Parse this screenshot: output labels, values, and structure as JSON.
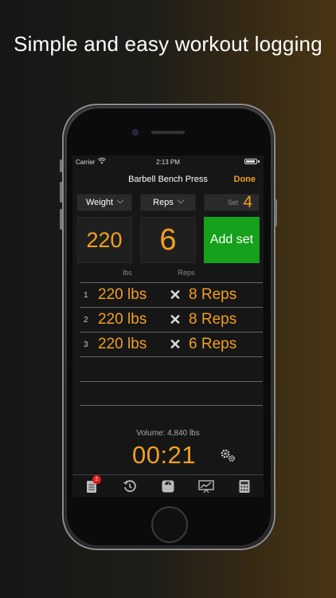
{
  "headline": "Simple and easy workout logging",
  "status_bar": {
    "carrier": "Carrier",
    "time": "2:13 PM"
  },
  "nav": {
    "title": "Barbell Bench Press",
    "done_label": "Done"
  },
  "selectors": {
    "weight_label": "Weight",
    "reps_label": "Reps",
    "set_label": "Set",
    "set_number": "4"
  },
  "inputs": {
    "weight_value": "220",
    "reps_value": "6",
    "weight_unit": "lbs",
    "reps_unit": "Reps"
  },
  "add_set_label": "Add set",
  "sets": [
    {
      "index": "1",
      "weight": "220 lbs",
      "separator": "✕",
      "reps": "8 Reps"
    },
    {
      "index": "2",
      "weight": "220 lbs",
      "separator": "✕",
      "reps": "8 Reps"
    },
    {
      "index": "3",
      "weight": "220 lbs",
      "separator": "✕",
      "reps": "6 Reps"
    }
  ],
  "volume": "Volume: 4,840 lbs",
  "timer": "00:21",
  "tabbar": {
    "items": [
      {
        "icon": "notepad-icon",
        "badge": "2"
      },
      {
        "icon": "history-icon"
      },
      {
        "icon": "scale-icon"
      },
      {
        "icon": "chart-icon"
      },
      {
        "icon": "calculator-icon"
      }
    ]
  },
  "colors": {
    "accent": "#f0a020",
    "add_set": "#15a11b",
    "badge": "#e21b1b"
  }
}
